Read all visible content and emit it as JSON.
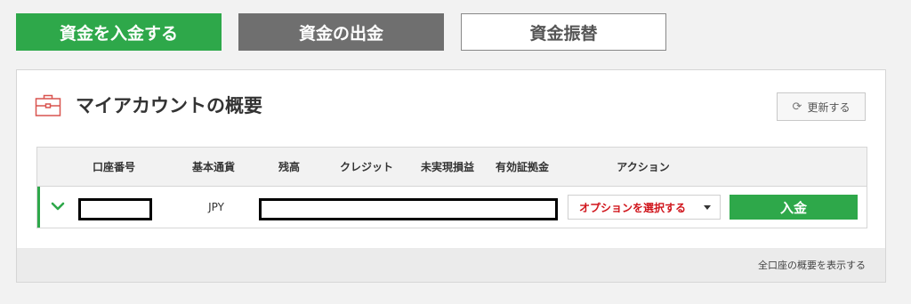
{
  "top_tabs": {
    "deposit": "資金を入金する",
    "withdraw": "資金の出金",
    "transfer": "資金振替"
  },
  "panel": {
    "title": "マイアカウントの概要",
    "refresh_label": "更新する",
    "refresh_icon": "refresh-icon",
    "header_icon": "briefcase-icon"
  },
  "table": {
    "headers": [
      "口座番号",
      "基本通貨",
      "残高",
      "クレジット",
      "未実現損益",
      "有効証拠金",
      "アクション"
    ],
    "rows": [
      {
        "account_number": "",
        "currency": "JPY",
        "action_select": "オプションを選択する",
        "deposit_button": "入金"
      }
    ]
  },
  "footer": {
    "show_all_link": "全口座の概要を表示する"
  },
  "colors": {
    "primary_green": "#2ea84a",
    "dark_gray": "#6f6f6f",
    "accent_red": "#d0141b",
    "icon_red": "#d9534f"
  }
}
